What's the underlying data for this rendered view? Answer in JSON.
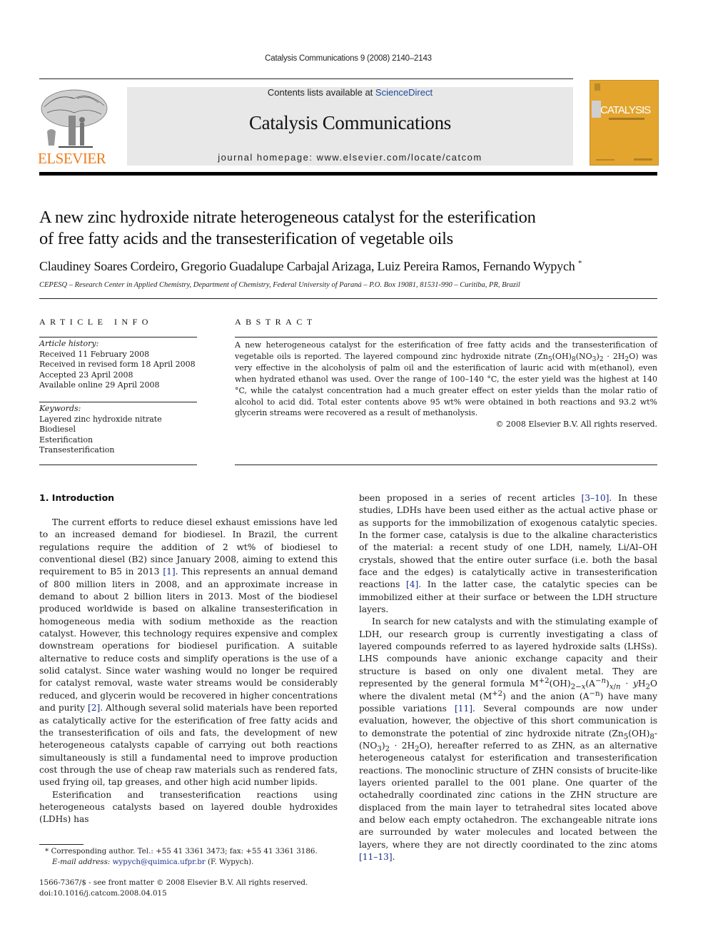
{
  "running_head": "Catalysis Communications 9 (2008) 2140–2143",
  "header": {
    "contents_prefix": "Contents lists available at ",
    "contents_link": "ScienceDirect",
    "journal_title": "Catalysis Communications",
    "homepage": "journal homepage: www.elsevier.com/locate/catcom",
    "publisher_logo_text": "ELSEVIER",
    "cover_title": "CATALYSIS",
    "brand_orange": "#f07c1a",
    "cover_color": "#e3a52e"
  },
  "article": {
    "title_line1": "A new zinc hydroxide nitrate heterogeneous catalyst for the esterification",
    "title_line2": "of free fatty acids and the transesterification of vegetable oils",
    "authors": "Claudiney Soares Cordeiro, Gregorio Guadalupe Carbajal Arizaga, Luiz Pereira Ramos, Fernando Wypych",
    "corresponding_mark": "*",
    "affiliation": "CEPESQ – Research Center in Applied Chemistry, Department of Chemistry, Federal University of Paraná – P.O. Box 19081, 81531-990 – Curitiba, PR, Brazil"
  },
  "article_info": {
    "heading": "ARTICLE INFO",
    "history_label": "Article history:",
    "history": [
      "Received 11 February 2008",
      "Received in revised form 18 April 2008",
      "Accepted 23 April 2008",
      "Available online 29 April 2008"
    ],
    "keywords_label": "Keywords:",
    "keywords": [
      "Layered zinc hydroxide nitrate",
      "Biodiesel",
      "Esterification",
      "Transesterification"
    ]
  },
  "abstract": {
    "heading": "ABSTRACT",
    "part1": "A new heterogeneous catalyst for the esterification of free fatty acids and the transesterification of vegetable oils is reported. The layered compound zinc hydroxide nitrate (",
    "part2": ") was very effective in the alcoholysis of palm oil and the esterification of lauric acid with m(ethanol), even when hydrated ethanol was used. Over the range of 100–140 °C, the ester yield was the highest at 140 °C, while the catalyst concentration had a much greater effect on ester yields than the molar ratio of alcohol to acid did. Total ester contents above 95 wt% were obtained in both reactions and 93.2 wt% glycerin streams were recovered as a result of methanolysis.",
    "copyright": "© 2008 Elsevier B.V. All rights reserved."
  },
  "intro": {
    "heading": "1. Introduction",
    "p1a": "The current efforts to reduce diesel exhaust emissions have led to an increased demand for biodiesel. In Brazil, the current regulations require the addition of 2 wt% of biodiesel to conventional diesel (B2) since January 2008, aiming to extend this requirement to B5 in 2013 ",
    "ref1": "[1]",
    "p1b": ". This represents an annual demand of 800 million liters in 2008, and an approximate increase in demand to about 2 billion liters in 2013. Most of the biodiesel produced worldwide is based on alkaline transesterification in homogeneous media with sodium methoxide as the reaction catalyst. However, this technology requires expensive and complex downstream operations for biodiesel purification. A suitable alternative to reduce costs and simplify operations is the use of a solid catalyst. Since water washing would no longer be required for catalyst removal, waste water streams would be considerably reduced, and glycerin would be recovered in higher concentrations and purity ",
    "ref2": "[2]",
    "p1c": ". Although several solid materials have been reported as catalytically active for the esterification of free fatty acids and the transesterification of oils and fats, the development of new heterogeneous catalysts capable of carrying out both reactions simultaneously is still a fundamental need to improve production cost through the use of cheap raw materials such as rendered fats, used frying oil, tap greases, and other high acid number lipids.",
    "p2a": "Esterification and transesterification reactions using heterogeneous catalysts based on layered double hydroxides (LDHs) has been proposed in a series of recent articles ",
    "ref3": "[3–10]",
    "p2b": ". In these studies, LDHs have been used either as the actual active phase or as supports for the immobilization of exogenous catalytic species. In the former case, catalysis is due to the alkaline characteristics of the material: a recent study of one LDH, namely, Li/Al–OH crystals, showed that the entire outer surface (i.e. both the basal face and the edges) is catalytically active in transesterification reactions ",
    "ref4": "[4]",
    "p2c": ". In the latter case, the catalytic species can be immobilized either at their surface or between the LDH structure layers.",
    "p3a": "In search for new catalysts and with the stimulating example of LDH, our research group is currently investigating a class of layered compounds referred to as layered hydroxide salts (LHSs). LHS compounds have anionic exchange capacity and their structure is based on only one divalent metal. They are represented by the general formula ",
    "p3b": " where the divalent metal (",
    "p3c": ") and the anion (",
    "p3d": ") have many possible variations ",
    "ref5": "[11]",
    "p3e": ". Several compounds are now under evaluation, however, the objective of this short communication is to demonstrate the potential of zinc hydroxide nitrate (",
    "p3f": "), hereafter referred to as ZHN, as an alternative heterogeneous catalyst for esterification and transesterification reactions. The monoclinic structure of ZHN consists of brucite-like layers oriented parallel to the 001 plane. One quarter of the octahedrally coordinated zinc cations in the ZHN structure are displaced from the main layer to tetrahedral sites located above and below each empty octahedron. The exchangeable nitrate ions are surrounded by water molecules and located between the layers, where they are not directly coordinated to the zinc atoms ",
    "ref6": "[11–13]",
    "p3g": "."
  },
  "footnote": {
    "mark": "*",
    "text": "Corresponding author. Tel.: +55 41 3361 3473; fax: +55 41 3361 3186.",
    "email_label": "E-mail address:",
    "email": "wypych@quimica.ufpr.br",
    "email_suffix": " (F. Wypych).",
    "issn": "1566-7367/$ - see front matter © 2008 Elsevier B.V. All rights reserved.",
    "doi": "doi:10.1016/j.catcom.2008.04.015"
  }
}
